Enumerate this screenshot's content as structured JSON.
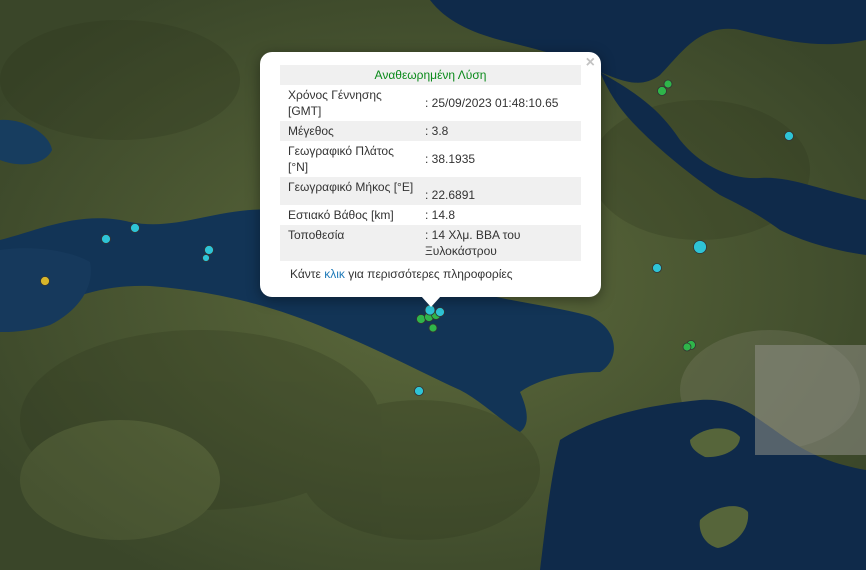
{
  "popup": {
    "title": "Αναθεωρημένη Λύση",
    "close_label": "×",
    "rows": [
      {
        "label": "Χρόνος Γέννησης [GMT]",
        "value": ": 25/09/2023 01:48:10.65"
      },
      {
        "label": "Μέγεθος",
        "value": ": 3.8"
      },
      {
        "label": "Γεωγραφικό Πλάτος [°N]",
        "value": ": 38.1935"
      },
      {
        "label": "Γεωγραφικό Μήκος [°E]",
        "value": ": 22.6891"
      },
      {
        "label": "Εστιακό Βάθος [km]",
        "value": ": 14.8"
      },
      {
        "label": "Τοποθεσία",
        "value": ": 14 Χλμ. ΒΒΑ του Ξυλοκάστρου"
      }
    ],
    "more_prefix": "Κάντε ",
    "more_link": "κλικ",
    "more_suffix": " για περισσότερες πληροφορίες"
  },
  "colors": {
    "sea": "#0f2a4a",
    "land": "#4a5a34",
    "marker_cyan": "#2ec4d6",
    "marker_green": "#2fb54a",
    "marker_yellow": "#d8b62a"
  }
}
